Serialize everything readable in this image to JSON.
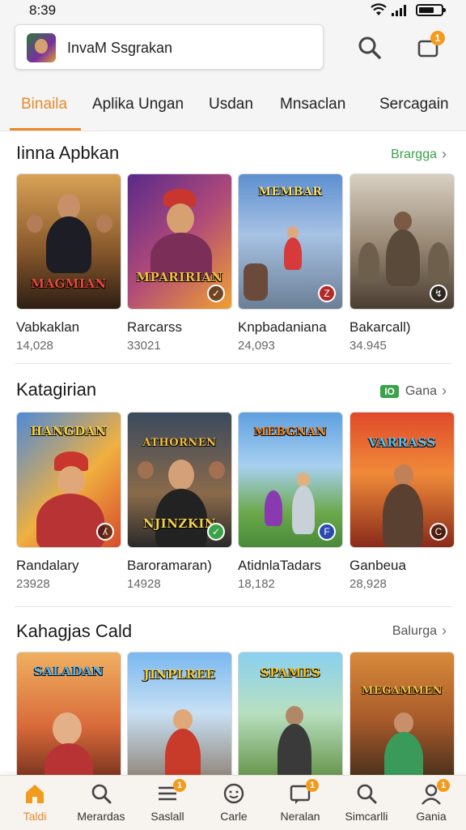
{
  "status": {
    "time": "8:39"
  },
  "header": {
    "search_text": "InvaM Ssgrakan",
    "notification_count": "1"
  },
  "tabs": [
    {
      "label": "Binaila",
      "active": true
    },
    {
      "label": "Aplika Ungan"
    },
    {
      "label": "Usdan"
    },
    {
      "label": "Mnsaclan"
    },
    {
      "label": "Sercagain"
    }
  ],
  "sections": [
    {
      "title": "Iinna Apbkan",
      "link": "Brargga",
      "link_color": "#3aa34a",
      "items": [
        {
          "name": "Vabkaklan",
          "count": "14,028",
          "art_title": "MAGMIAN"
        },
        {
          "name": "Rarcarss",
          "count": "33021",
          "art_title": "MPARIRIAN"
        },
        {
          "name": "Knpbadaniana",
          "count": "24,093",
          "art_title": "MEMBAR"
        },
        {
          "name": "Bakarcall)",
          "count": "34.945",
          "art_title": ""
        }
      ]
    },
    {
      "title": "Katagirian",
      "link": "Gana",
      "link_tag": "IO",
      "link_color": "#555555",
      "items": [
        {
          "name": "Randalary",
          "count": "23928",
          "art_title": "HANGDAN"
        },
        {
          "name": "Baroramaran)",
          "count": "14928",
          "art_title": "NJINZKIN"
        },
        {
          "name": "AtidnlaTadars",
          "count": "18,182",
          "art_title": "MEBGNAN"
        },
        {
          "name": "Ganbeua",
          "count": "28,928",
          "art_title": "VARRASS"
        }
      ]
    },
    {
      "title": "Kahagjas Cald",
      "link": "Balurga",
      "link_color": "#555555",
      "items": [
        {
          "name": "",
          "count": "",
          "art_title": "SALADAN"
        },
        {
          "name": "",
          "count": "",
          "art_title": "JINPLREE"
        },
        {
          "name": "",
          "count": "",
          "art_title": "SPAMES"
        },
        {
          "name": "",
          "count": "",
          "art_title": "MEGAMMEN"
        }
      ]
    }
  ],
  "bottom_nav": [
    {
      "label": "Taldi",
      "icon": "home-icon",
      "active": true
    },
    {
      "label": "Merardas",
      "icon": "search-icon"
    },
    {
      "label": "Saslall",
      "icon": "list-icon",
      "badge": "1"
    },
    {
      "label": "Carle",
      "icon": "smile-icon"
    },
    {
      "label": "Neralan",
      "icon": "message-icon",
      "badge": "1"
    },
    {
      "label": "Simcarlli",
      "icon": "search-icon"
    },
    {
      "label": "Gania",
      "icon": "profile-icon",
      "badge": "1"
    }
  ],
  "colors": {
    "accent": "#e8892c",
    "badge": "#f29b1d",
    "ad_green": "#3aa34a"
  }
}
